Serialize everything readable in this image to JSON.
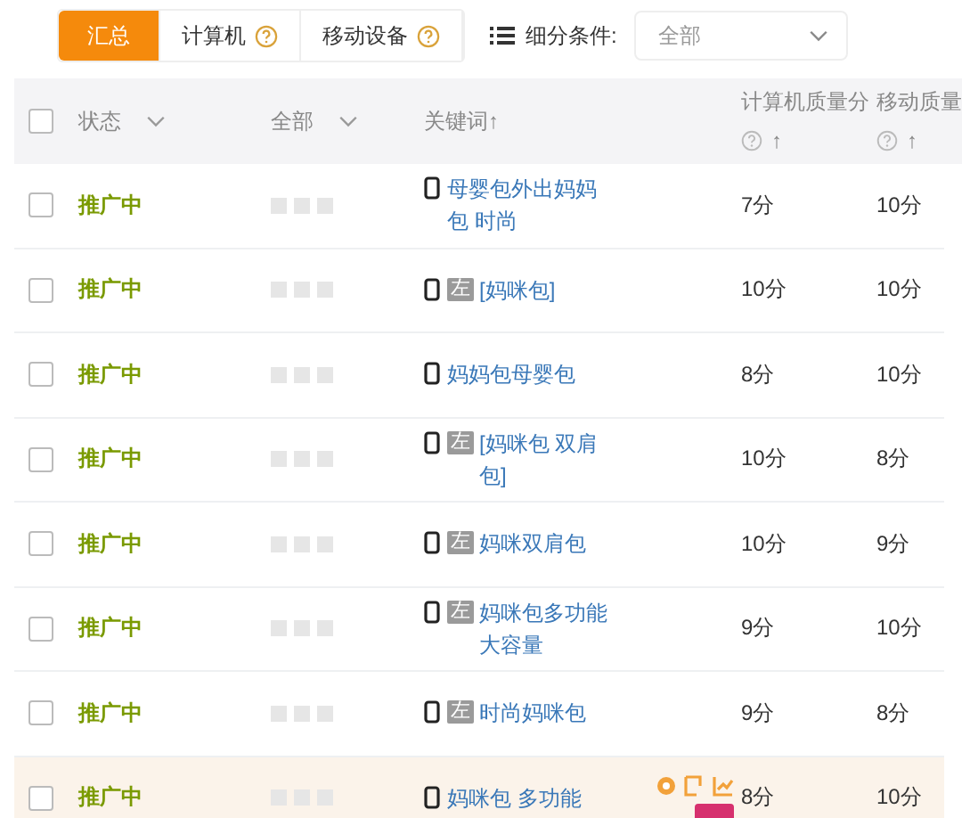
{
  "tabs": [
    {
      "label": "汇总",
      "selected": true,
      "help": false
    },
    {
      "label": "计算机",
      "selected": false,
      "help": true
    },
    {
      "label": "移动设备",
      "selected": false,
      "help": true
    }
  ],
  "filter": {
    "label": "细分条件:",
    "value": "全部"
  },
  "table": {
    "all_checked": false,
    "columns": [
      {
        "label": "状态",
        "kind": "dropdown"
      },
      {
        "label": "全部",
        "kind": "dropdown"
      },
      {
        "label": "关键词",
        "kind": "sort",
        "arrow": "↑"
      },
      {
        "label": "计算机质量分",
        "kind": "help_sort",
        "arrow": "↑"
      },
      {
        "label": "移动质量",
        "kind": "help_sort",
        "arrow": "↑"
      }
    ],
    "rows": [
      {
        "checked": false,
        "highlighted": false,
        "status": "推广中",
        "keyword": "母婴包外出妈妈包 时尚",
        "pc_score": "7分",
        "mobile_score": "10分"
      },
      {
        "checked": false,
        "highlighted": false,
        "status": "推广中",
        "badge": "左",
        "keyword": "[妈咪包]",
        "pc_score": "10分",
        "mobile_score": "10分"
      },
      {
        "checked": false,
        "highlighted": false,
        "status": "推广中",
        "keyword": "妈妈包母婴包",
        "pc_score": "8分",
        "mobile_score": "10分"
      },
      {
        "checked": false,
        "highlighted": false,
        "status": "推广中",
        "badge": "左",
        "keyword": "[妈咪包 双肩包]",
        "pc_score": "10分",
        "mobile_score": "8分"
      },
      {
        "checked": false,
        "highlighted": false,
        "status": "推广中",
        "badge": "左",
        "keyword": "妈咪双肩包",
        "pc_score": "10分",
        "mobile_score": "9分"
      },
      {
        "checked": false,
        "highlighted": false,
        "status": "推广中",
        "badge": "左",
        "keyword": "妈咪包多功能大容量",
        "pc_score": "9分",
        "mobile_score": "10分"
      },
      {
        "checked": false,
        "highlighted": false,
        "status": "推广中",
        "badge": "左",
        "keyword": "时尚妈咪包",
        "pc_score": "9分",
        "mobile_score": "8分"
      },
      {
        "checked": false,
        "highlighted": true,
        "status": "推广中",
        "keyword": "妈咪包 多功能",
        "pc_score": "8分",
        "mobile_score": "10分"
      }
    ]
  }
}
